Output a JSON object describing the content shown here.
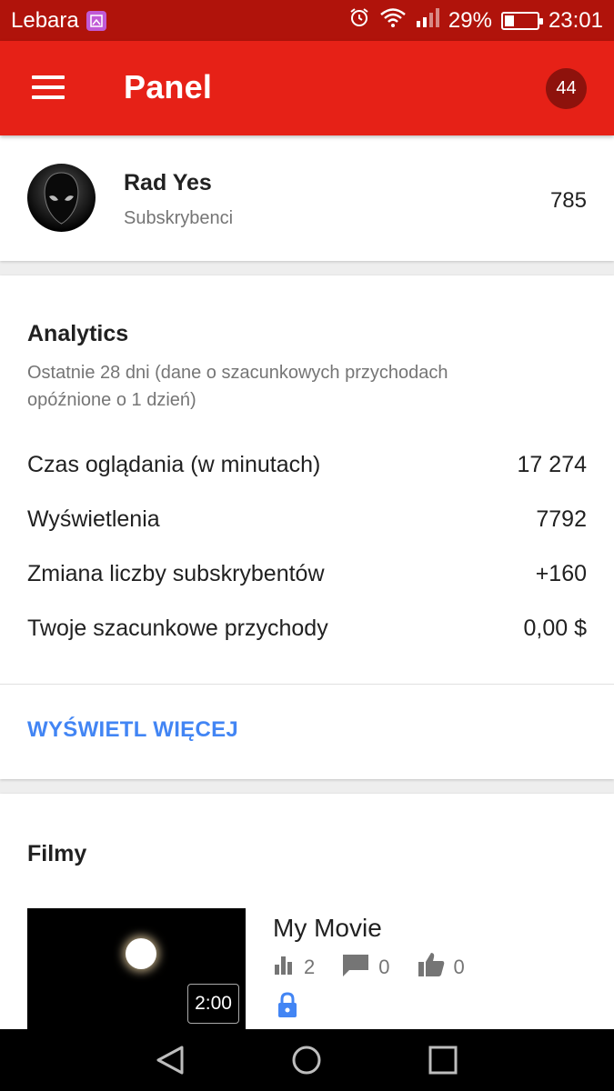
{
  "status_bar": {
    "carrier": "Lebara",
    "battery": "29%",
    "battery_level": 0.29,
    "time": "23:01",
    "icons": [
      "gallery-icon",
      "alarm-icon",
      "wifi-icon",
      "signal-icon",
      "battery-icon"
    ]
  },
  "app_bar": {
    "title": "Panel",
    "notification_count": "44",
    "menu_icon": "hamburger-menu-icon"
  },
  "channel": {
    "name": "Rad Yes",
    "subtitle": "Subskrybenci",
    "subscribers": "785"
  },
  "analytics": {
    "title": "Analytics",
    "subtitle": "Ostatnie 28 dni (dane o szacunkowych przychodach opóźnione o 1 dzień)",
    "rows": [
      {
        "label": "Czas oglądania (w minutach)",
        "value": "17 274"
      },
      {
        "label": "Wyświetlenia",
        "value": "7792"
      },
      {
        "label": "Zmiana liczby subskrybentów",
        "value": "+160"
      },
      {
        "label": "Twoje szacunkowe przychody",
        "value": "0,00 $"
      }
    ],
    "more_label": "WYŚWIETL WIĘCEJ"
  },
  "films": {
    "title": "Filmy",
    "videos": [
      {
        "title": "My Movie",
        "duration": "2:00",
        "views": "2",
        "comments": "0",
        "likes": "0",
        "private": true
      }
    ]
  },
  "colors": {
    "status_bar": "#b0130b",
    "app_bar": "#e62117",
    "badge": "#8e120c",
    "link": "#4285f4",
    "lock": "#4285f4"
  }
}
